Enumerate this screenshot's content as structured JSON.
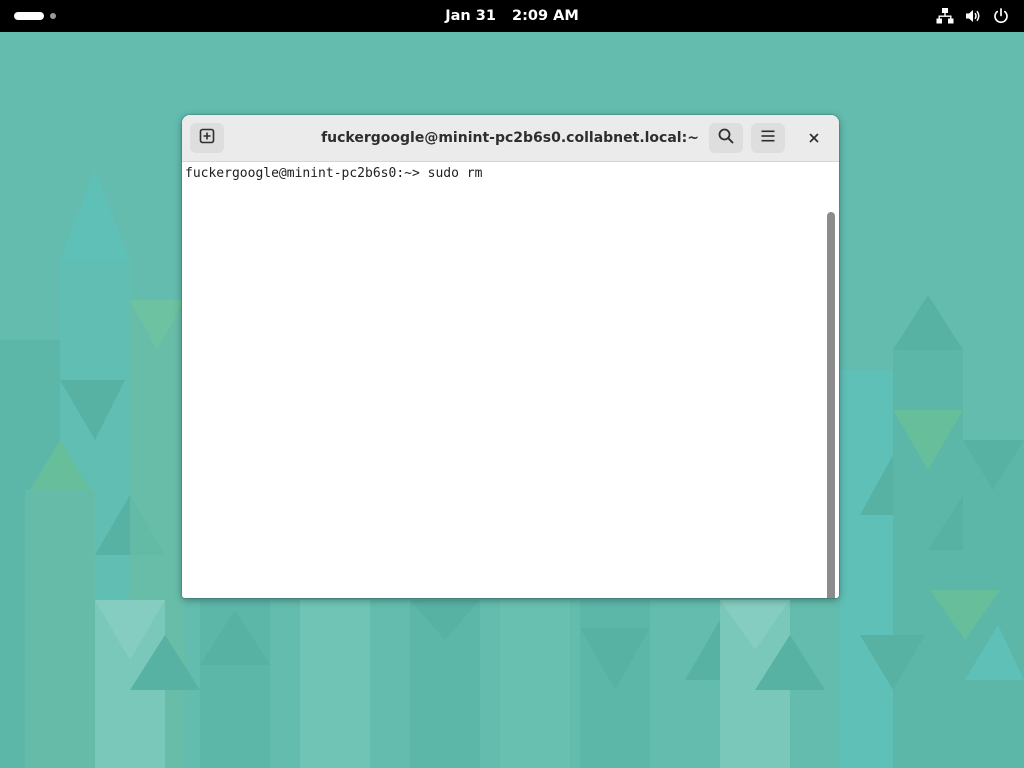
{
  "topbar": {
    "date": "Jan 31",
    "time": "2:09 AM",
    "tray_icons": [
      "network-wired-icon",
      "volume-icon",
      "power-icon"
    ]
  },
  "terminal": {
    "title": "fuckergoogle@minint-pc2b6s0.collabnet.local:~",
    "prompt": "fuckergoogle@minint-pc2b6s0:~>",
    "command": "sudo rm",
    "buttons": {
      "new_tab": "new-tab-icon",
      "search": "search-icon",
      "menu": "hamburger-menu-icon",
      "close": "close-icon"
    }
  },
  "colors": {
    "wallpaper_base": "#63bcae",
    "topbar": "#000000",
    "headerbar": "#ebebeb",
    "terminal_bg": "#ffffff"
  }
}
